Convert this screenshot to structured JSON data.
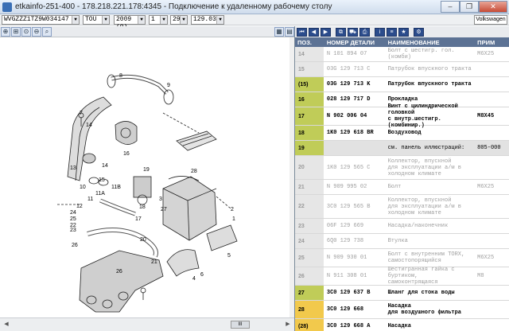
{
  "window": {
    "title": "etkainfo-251-400 - 178.218.221.178:4345 - Подключение к удаленному рабочему столу"
  },
  "selectors": {
    "vin": "WVGZZZ1TZ9W034147",
    "model": "TOU",
    "year": "2009 (9)",
    "main_group": "1",
    "sub_group": "29",
    "illustration": "129.030",
    "brand": "Volkswagen"
  },
  "columns": {
    "pos": "ПОЗ.",
    "part": "НОМЕР ДЕТАЛИ",
    "name": "НАИМЕНОВАНИЕ",
    "spec": "ПРИМ"
  },
  "rows": [
    {
      "pos": "14",
      "part": "N 101 894 07",
      "name": [
        "Болт с шестигр. гол. (комби)"
      ],
      "spec": "M6X25",
      "style": "dim"
    },
    {
      "pos": "15",
      "part": "03G 129 713 C",
      "name": [
        "Патрубок впускного тракта"
      ],
      "spec": "",
      "style": "dim"
    },
    {
      "pos": "(15)",
      "part": "03G 129 713 K",
      "name": [
        "Патрубок впускного тракта"
      ],
      "spec": "",
      "style": "normal"
    },
    {
      "pos": "16",
      "part": "028 129 717 D",
      "name": [
        "Прокладка"
      ],
      "spec": "",
      "style": "normal"
    },
    {
      "pos": "17",
      "part": "N 902 006 04",
      "name": [
        "Винт с цилиндрической головкой",
        "с внутр.шестигр. (комбинир.)"
      ],
      "spec": "M8X45",
      "style": "normal"
    },
    {
      "pos": "18",
      "part": "1K0 129 618 BR",
      "name": [
        "Воздуховод"
      ],
      "spec": "",
      "style": "normal"
    },
    {
      "pos": "19",
      "part": "",
      "name": [
        "см. панель иллюстраций:"
      ],
      "spec": "805-000",
      "style": "sel19"
    },
    {
      "pos": "20",
      "part": "1K0 129 565 C",
      "name": [
        "Коллектор, впускной",
        "для эксплуатации а/м в",
        "холодном климате"
      ],
      "spec": "",
      "style": "dim"
    },
    {
      "pos": "21",
      "part": "N 909 995 02",
      "name": [
        "Болт"
      ],
      "spec": "M6X25",
      "style": "dim"
    },
    {
      "pos": "22",
      "part": "3C0 129 565 B",
      "name": [
        "Коллектор, впускной",
        "для эксплуатации а/м в",
        "холодном климате"
      ],
      "spec": "",
      "style": "dim"
    },
    {
      "pos": "23",
      "part": "06F 129 669",
      "name": [
        "Насадка/наконечник"
      ],
      "spec": "",
      "style": "dim"
    },
    {
      "pos": "24",
      "part": "6Q0 129 738",
      "name": [
        "Втулка"
      ],
      "spec": "",
      "style": "dim"
    },
    {
      "pos": "25",
      "part": "N 909 930 01",
      "name": [
        "Болт с внутренним TORX,",
        "самостопорящийся"
      ],
      "spec": "M6X25",
      "style": "dim"
    },
    {
      "pos": "26",
      "part": "N 911 308 01",
      "name": [
        "Шестигранная гайка с буртиком,",
        "самоконтрящаяся"
      ],
      "spec": "M8",
      "style": "dim"
    },
    {
      "pos": "27",
      "part": "3C0 129 637 B",
      "name": [
        "Шланг для стока воды"
      ],
      "spec": "",
      "style": "normal"
    },
    {
      "pos": "28",
      "part": "3C0 129 668",
      "name": [
        "Насадка",
        "для воздушного фильтра"
      ],
      "spec": "",
      "style": "normal yellow"
    },
    {
      "pos": "(28)",
      "part": "3C0 129 668 A",
      "name": [
        "Насадка"
      ],
      "spec": "",
      "style": "normal yellow"
    }
  ],
  "diagram_labels": [
    "7",
    "8",
    "9",
    "10",
    "11",
    "11A",
    "11B",
    "12",
    "13",
    "14",
    "15",
    "16",
    "17",
    "18",
    "19",
    "20",
    "21",
    "22",
    "23",
    "24",
    "25",
    "26",
    "27",
    "28",
    "1",
    "2",
    "3",
    "4",
    "5",
    "6",
    "26",
    "14"
  ],
  "colors": {
    "header_bg": "#5c7294",
    "pos_green": "#c0cc58",
    "pos_yellow": "#f2c94c",
    "toolbar_btn": "#2b4c8c"
  }
}
